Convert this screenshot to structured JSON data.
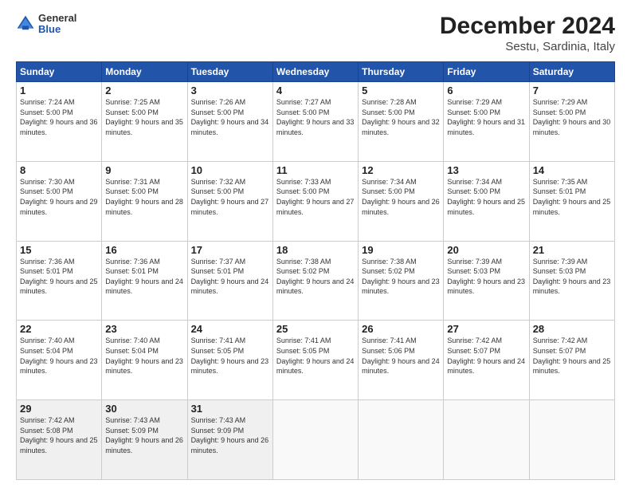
{
  "logo": {
    "general": "General",
    "blue": "Blue"
  },
  "title": "December 2024",
  "subtitle": "Sestu, Sardinia, Italy",
  "weekdays": [
    "Sunday",
    "Monday",
    "Tuesday",
    "Wednesday",
    "Thursday",
    "Friday",
    "Saturday"
  ],
  "weeks": [
    [
      {
        "day": 1,
        "sunrise": "7:24 AM",
        "sunset": "5:00 PM",
        "daylight": "9 hours and 36 minutes."
      },
      {
        "day": 2,
        "sunrise": "7:25 AM",
        "sunset": "5:00 PM",
        "daylight": "9 hours and 35 minutes."
      },
      {
        "day": 3,
        "sunrise": "7:26 AM",
        "sunset": "5:00 PM",
        "daylight": "9 hours and 34 minutes."
      },
      {
        "day": 4,
        "sunrise": "7:27 AM",
        "sunset": "5:00 PM",
        "daylight": "9 hours and 33 minutes."
      },
      {
        "day": 5,
        "sunrise": "7:28 AM",
        "sunset": "5:00 PM",
        "daylight": "9 hours and 32 minutes."
      },
      {
        "day": 6,
        "sunrise": "7:29 AM",
        "sunset": "5:00 PM",
        "daylight": "9 hours and 31 minutes."
      },
      {
        "day": 7,
        "sunrise": "7:29 AM",
        "sunset": "5:00 PM",
        "daylight": "9 hours and 30 minutes."
      }
    ],
    [
      {
        "day": 8,
        "sunrise": "7:30 AM",
        "sunset": "5:00 PM",
        "daylight": "9 hours and 29 minutes."
      },
      {
        "day": 9,
        "sunrise": "7:31 AM",
        "sunset": "5:00 PM",
        "daylight": "9 hours and 28 minutes."
      },
      {
        "day": 10,
        "sunrise": "7:32 AM",
        "sunset": "5:00 PM",
        "daylight": "9 hours and 27 minutes."
      },
      {
        "day": 11,
        "sunrise": "7:33 AM",
        "sunset": "5:00 PM",
        "daylight": "9 hours and 27 minutes."
      },
      {
        "day": 12,
        "sunrise": "7:34 AM",
        "sunset": "5:00 PM",
        "daylight": "9 hours and 26 minutes."
      },
      {
        "day": 13,
        "sunrise": "7:34 AM",
        "sunset": "5:00 PM",
        "daylight": "9 hours and 25 minutes."
      },
      {
        "day": 14,
        "sunrise": "7:35 AM",
        "sunset": "5:01 PM",
        "daylight": "9 hours and 25 minutes."
      }
    ],
    [
      {
        "day": 15,
        "sunrise": "7:36 AM",
        "sunset": "5:01 PM",
        "daylight": "9 hours and 25 minutes."
      },
      {
        "day": 16,
        "sunrise": "7:36 AM",
        "sunset": "5:01 PM",
        "daylight": "9 hours and 24 minutes."
      },
      {
        "day": 17,
        "sunrise": "7:37 AM",
        "sunset": "5:01 PM",
        "daylight": "9 hours and 24 minutes."
      },
      {
        "day": 18,
        "sunrise": "7:38 AM",
        "sunset": "5:02 PM",
        "daylight": "9 hours and 24 minutes."
      },
      {
        "day": 19,
        "sunrise": "7:38 AM",
        "sunset": "5:02 PM",
        "daylight": "9 hours and 23 minutes."
      },
      {
        "day": 20,
        "sunrise": "7:39 AM",
        "sunset": "5:03 PM",
        "daylight": "9 hours and 23 minutes."
      },
      {
        "day": 21,
        "sunrise": "7:39 AM",
        "sunset": "5:03 PM",
        "daylight": "9 hours and 23 minutes."
      }
    ],
    [
      {
        "day": 22,
        "sunrise": "7:40 AM",
        "sunset": "5:04 PM",
        "daylight": "9 hours and 23 minutes."
      },
      {
        "day": 23,
        "sunrise": "7:40 AM",
        "sunset": "5:04 PM",
        "daylight": "9 hours and 23 minutes."
      },
      {
        "day": 24,
        "sunrise": "7:41 AM",
        "sunset": "5:05 PM",
        "daylight": "9 hours and 23 minutes."
      },
      {
        "day": 25,
        "sunrise": "7:41 AM",
        "sunset": "5:05 PM",
        "daylight": "9 hours and 24 minutes."
      },
      {
        "day": 26,
        "sunrise": "7:41 AM",
        "sunset": "5:06 PM",
        "daylight": "9 hours and 24 minutes."
      },
      {
        "day": 27,
        "sunrise": "7:42 AM",
        "sunset": "5:07 PM",
        "daylight": "9 hours and 24 minutes."
      },
      {
        "day": 28,
        "sunrise": "7:42 AM",
        "sunset": "5:07 PM",
        "daylight": "9 hours and 25 minutes."
      }
    ],
    [
      {
        "day": 29,
        "sunrise": "7:42 AM",
        "sunset": "5:08 PM",
        "daylight": "9 hours and 25 minutes."
      },
      {
        "day": 30,
        "sunrise": "7:43 AM",
        "sunset": "5:09 PM",
        "daylight": "9 hours and 26 minutes."
      },
      {
        "day": 31,
        "sunrise": "7:43 AM",
        "sunset": "9:09 PM",
        "daylight": "9 hours and 26 minutes."
      },
      null,
      null,
      null,
      null
    ]
  ]
}
